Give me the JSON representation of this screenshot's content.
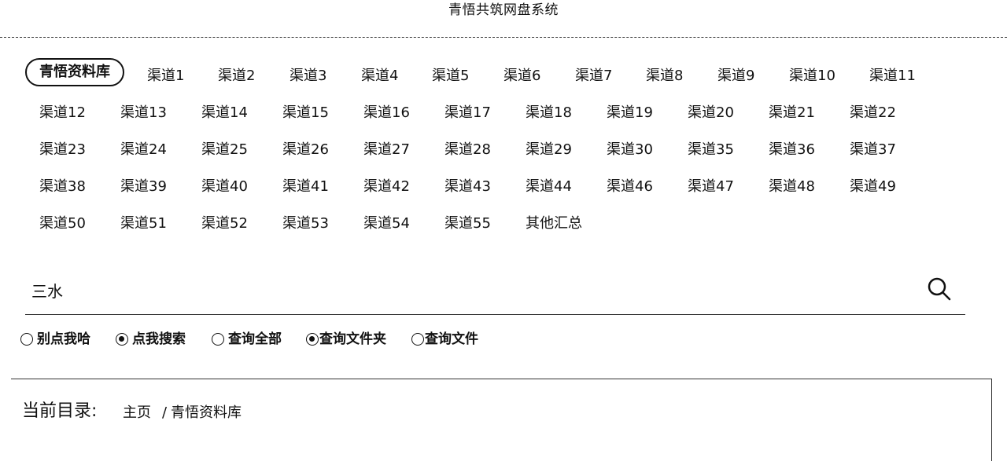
{
  "app": {
    "title": "青悟共筑网盘系统"
  },
  "channels": [
    "青悟资料库",
    "渠道1",
    "渠道2",
    "渠道3",
    "渠道4",
    "渠道5",
    "渠道6",
    "渠道7",
    "渠道8",
    "渠道9",
    "渠道10",
    "渠道11",
    "渠道12",
    "渠道13",
    "渠道14",
    "渠道15",
    "渠道16",
    "渠道17",
    "渠道18",
    "渠道19",
    "渠道20",
    "渠道21",
    "渠道22",
    "渠道23",
    "渠道24",
    "渠道25",
    "渠道26",
    "渠道27",
    "渠道28",
    "渠道29",
    "渠道30",
    "渠道35",
    "渠道36",
    "渠道37",
    "渠道38",
    "渠道39",
    "渠道40",
    "渠道41",
    "渠道42",
    "渠道43",
    "渠道44",
    "渠道46",
    "渠道47",
    "渠道48",
    "渠道49",
    "渠道50",
    "渠道51",
    "渠道52",
    "渠道53",
    "渠道54",
    "渠道55",
    "其他汇总"
  ],
  "active_channel": "青悟资料库",
  "search": {
    "value": "三水",
    "icon": "search-icon"
  },
  "radio_options": [
    {
      "label": "别点我哈",
      "checked": false
    },
    {
      "label": "点我搜索",
      "checked": true
    },
    {
      "label": "查询全部",
      "checked": false
    },
    {
      "label": "查询文件夹",
      "checked": true
    },
    {
      "label": "查询文件",
      "checked": false
    }
  ],
  "directory": {
    "label": "当前目录:",
    "breadcrumb": [
      "主页",
      "青悟资料库"
    ],
    "separator": "/"
  }
}
